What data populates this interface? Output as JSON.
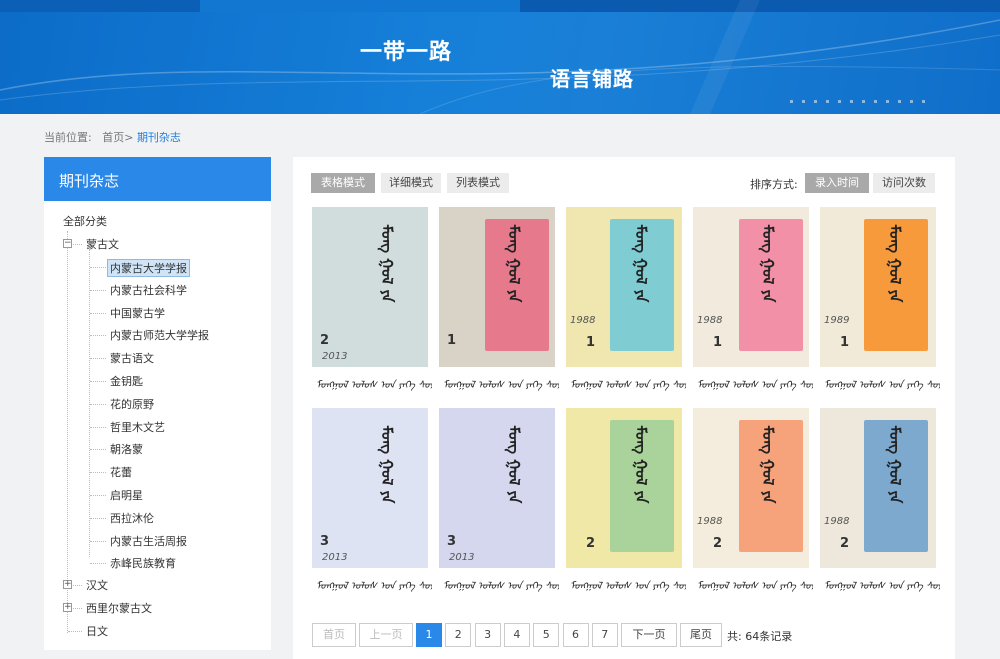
{
  "banner": {
    "line1": "一带一路",
    "line2": "语言铺路"
  },
  "breadcrumb": {
    "prefix": "当前位置:",
    "home": "首页>",
    "current": "期刊杂志"
  },
  "sidebar": {
    "title": "期刊杂志",
    "root": "全部分类",
    "groups": [
      {
        "label": "蒙古文",
        "expanded": true
      },
      {
        "label": "汉文",
        "expanded": false
      },
      {
        "label": "西里尔蒙古文",
        "expanded": false
      },
      {
        "label": "日文",
        "expanded": false
      }
    ],
    "mongolian_items": [
      "内蒙古大学学报",
      "内蒙古社会科学",
      "中国蒙古学",
      "内蒙古师范大学学报",
      "蒙古语文",
      "金钥匙",
      "花的原野",
      "哲里木文艺",
      "朝洛蒙",
      "花蕾",
      "启明星",
      "西拉沐伦",
      "内蒙古生活周报",
      "赤峰民族教育"
    ],
    "selected": "内蒙古大学学报"
  },
  "toolbar": {
    "view_modes": [
      "表格模式",
      "详细模式",
      "列表模式"
    ],
    "active_view": "表格模式",
    "sort_label": "排序方式:",
    "sort_options": [
      "录入时间",
      "访问次数"
    ],
    "active_sort": "录入时间"
  },
  "covers": [
    {
      "bg": "#c9d6d9",
      "panel": "#d9e3e2",
      "num": "2",
      "year": "2013",
      "caption": "ᠮᠣᠩᠭᠣᠯ ᠤᠯᠤᠰ ᠤᠨ ᠶᠡᠬᠡ ᠰᠤᠷᠭᠠᠭᠤᠯᠢ"
    },
    {
      "bg": "#d9d2c6",
      "panel": "#e67a8c",
      "num": "1",
      "year": "",
      "caption": "ᠮᠣᠩᠭᠣᠯ ᠤᠯᠤᠰ ᠤᠨ ᠶᠡᠬᠡ ᠰᠤᠷᠭᠠᠭᠤᠯᠢ"
    },
    {
      "bg": "#efe6b0",
      "panel": "#7fcdd3",
      "num": "1",
      "year": "1988",
      "caption": "ᠮᠣᠩᠭᠣᠯ ᠤᠯᠤᠰ ᠤᠨ ᠶᠡᠬᠡ ᠰᠤᠷᠭᠠᠭᠤᠯᠢ"
    },
    {
      "bg": "#f2eadd",
      "panel": "#f190a6",
      "num": "1",
      "year": "1988",
      "caption": "ᠮᠣᠩᠭᠣᠯ ᠤᠯᠤᠰ ᠤᠨ ᠶᠡᠬᠡ ᠰᠤᠷᠭᠠᠭᠤᠯᠢ"
    },
    {
      "bg": "#f1ead8",
      "panel": "#f79a3c",
      "num": "1",
      "year": "1989",
      "caption": "ᠮᠣᠩᠭᠣᠯ ᠤᠯᠤᠰ ᠤᠨ ᠶᠡᠬᠡ ᠰᠤᠷᠭᠠᠭᠤᠯᠢ"
    },
    {
      "bg": "#d8dff0",
      "panel": "#e3e8f5",
      "num": "3",
      "year": "2013",
      "caption": "ᠮᠣᠩᠭᠣᠯ ᠤᠯᠤᠰ ᠤᠨ ᠶᠡᠬᠡ ᠰᠤᠷᠭᠠᠭᠤᠯᠢ"
    },
    {
      "bg": "#cbcfe8",
      "panel": "#dde0f2",
      "num": "3",
      "year": "2013",
      "caption": "ᠮᠣᠩᠭᠣᠯ ᠤᠯᠤᠰ ᠤᠨ ᠶᠡᠬᠡ ᠰᠤᠷᠭᠠᠭᠤᠯᠢ"
    },
    {
      "bg": "#efe8a6",
      "panel": "#a9d39a",
      "num": "2",
      "year": "",
      "caption": "ᠮᠣᠩᠭᠣᠯ ᠤᠯᠤᠰ ᠤᠨ ᠶᠡᠬᠡ ᠰᠤᠷᠭᠠᠭᠤᠯᠢ"
    },
    {
      "bg": "#f4ecdc",
      "panel": "#f6a27a",
      "num": "2",
      "year": "1988",
      "caption": "ᠮᠣᠩᠭᠣᠯ ᠤᠯᠤᠰ ᠤᠨ ᠶᠡᠬᠡ ᠰᠤᠷᠭᠠᠭᠤᠯᠢ"
    },
    {
      "bg": "#eee8dc",
      "panel": "#7ea9cf",
      "num": "2",
      "year": "1988",
      "caption": "ᠮᠣᠩᠭᠣᠯ ᠤᠯᠤᠰ ᠤᠨ ᠶᠡᠬᠡ ᠰᠤᠷᠭᠠᠭᠤᠯᠢ"
    }
  ],
  "pagination": {
    "first": "首页",
    "prev": "上一页",
    "pages": [
      "1",
      "2",
      "3",
      "4",
      "5",
      "6",
      "7"
    ],
    "current": "1",
    "next": "下一页",
    "last": "尾页",
    "total": "共:  64条记录"
  }
}
